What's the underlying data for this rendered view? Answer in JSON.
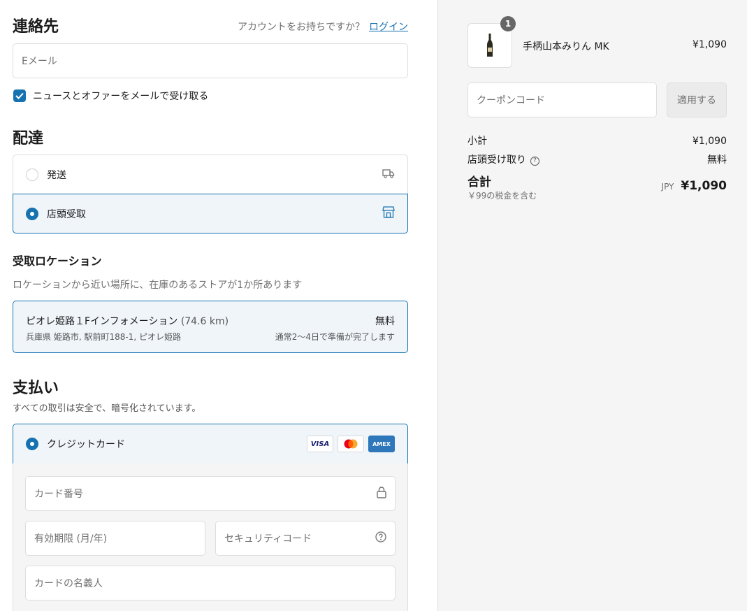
{
  "contact": {
    "title": "連絡先",
    "has_account_text": "アカウントをお持ちですか？",
    "login_link": "ログイン",
    "email_placeholder": "Eメール",
    "newsletter_label": "ニュースとオファーをメールで受け取る",
    "newsletter_checked": true
  },
  "delivery": {
    "title": "配達",
    "options": [
      {
        "label": "発送",
        "icon": "truck-icon",
        "selected": false
      },
      {
        "label": "店頭受取",
        "icon": "store-icon",
        "selected": true
      }
    ]
  },
  "pickup": {
    "title": "受取ロケーション",
    "description": "ロケーションから近い場所に、在庫のあるストアが1か所あります",
    "location": {
      "name": "ピオレ姫路１Fインフォメーション",
      "distance": "(74.6 km)",
      "address": "兵庫県 姫路市, 駅前町188-1, ピオレ姫路",
      "price": "無料",
      "eta": "通常2〜4日で準備が完了します"
    }
  },
  "payment": {
    "title": "支払い",
    "description": "すべての取引は安全で、暗号化されています。",
    "method_label": "クレジットカード",
    "cards": [
      "VISA",
      "",
      "AMEX"
    ],
    "card_number_placeholder": "カード番号",
    "expiry_placeholder": "有効期限 (月/年)",
    "cvc_placeholder": "セキュリティコード",
    "name_placeholder": "カードの名義人"
  },
  "summary": {
    "item": {
      "name": "手柄山本みりん MK",
      "price": "¥1,090",
      "quantity": "1"
    },
    "coupon_placeholder": "クーポンコード",
    "apply_label": "適用する",
    "subtotal_label": "小計",
    "subtotal_value": "¥1,090",
    "pickup_label": "店頭受け取り",
    "pickup_value": "無料",
    "total_label": "合計",
    "tax_note": "￥99の税金を含む",
    "currency": "JPY",
    "total_value": "¥1,090"
  },
  "colors": {
    "accent": "#1773b0",
    "selected_bg": "#f0f5fa",
    "sidebar_bg": "#f5f5f5"
  }
}
